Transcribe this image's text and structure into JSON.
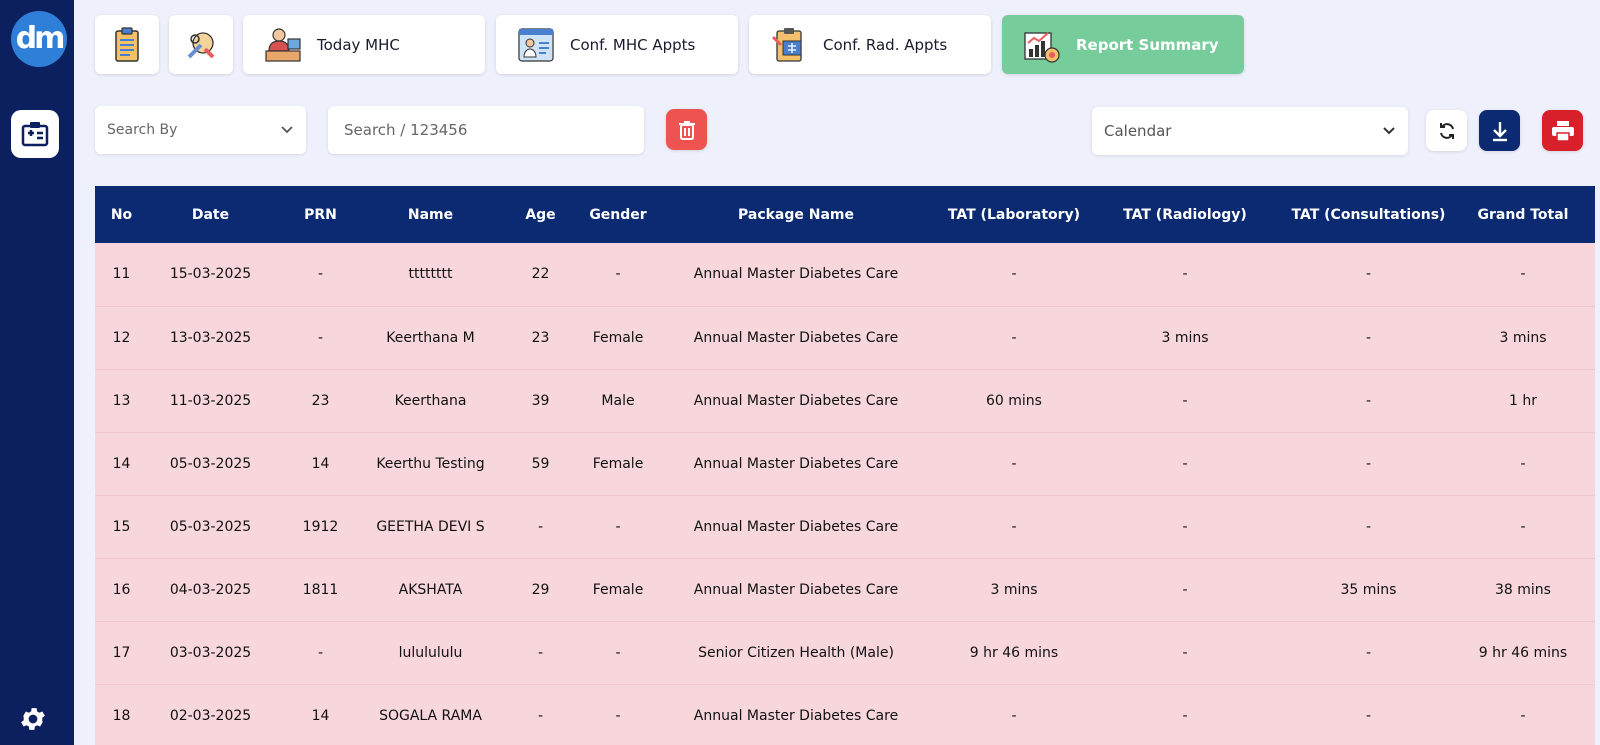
{
  "app": {
    "logo_text": "dm"
  },
  "sidebar": {
    "settings_icon": "gear-icon",
    "nav_icon": "medical-id-icon"
  },
  "tiles": [
    {
      "label": "",
      "icon": "clipboard-icon"
    },
    {
      "label": "",
      "icon": "tools-icon"
    },
    {
      "label": "Today MHC",
      "icon": "doctor-desk-icon"
    },
    {
      "label": "Conf. MHC Appts",
      "icon": "doctor-card-icon"
    },
    {
      "label": "Conf. Rad. Appts",
      "icon": "radiology-clipboard-icon"
    },
    {
      "label": "Report Summary",
      "icon": "report-chart-icon",
      "active": true
    }
  ],
  "filters": {
    "search_by": "Search By",
    "search_placeholder": "Search / 123456",
    "calendar": "Calendar"
  },
  "colors": {
    "sidebar": "#0c1f5e",
    "header": "#0c2a72",
    "row": "#f7d7dc",
    "active_tile": "#76cc9b",
    "danger": "#e53e3e",
    "download": "#0c2a72"
  },
  "table": {
    "columns": [
      "No",
      "Date",
      "PRN",
      "Name",
      "Age",
      "Gender",
      "Package Name",
      "TAT (Laboratory)",
      "TAT (Radiology)",
      "TAT (Consultations)",
      "Grand Total"
    ],
    "rows": [
      [
        "11",
        "15-03-2025",
        "-",
        "tttttttt",
        "22",
        "-",
        "Annual Master Diabetes Care",
        "-",
        "-",
        "-",
        "-"
      ],
      [
        "12",
        "13-03-2025",
        "-",
        "Keerthana M",
        "23",
        "Female",
        "Annual Master Diabetes Care",
        "-",
        "3 mins",
        "-",
        "3 mins"
      ],
      [
        "13",
        "11-03-2025",
        "23",
        "Keerthana",
        "39",
        "Male",
        "Annual Master Diabetes Care",
        "60 mins",
        "-",
        "-",
        "1 hr"
      ],
      [
        "14",
        "05-03-2025",
        "14",
        "Keerthu Testing",
        "59",
        "Female",
        "Annual Master Diabetes Care",
        "-",
        "-",
        "-",
        "-"
      ],
      [
        "15",
        "05-03-2025",
        "1912",
        "GEETHA DEVI S",
        "-",
        "-",
        "Annual Master Diabetes Care",
        "-",
        "-",
        "-",
        "-"
      ],
      [
        "16",
        "04-03-2025",
        "1811",
        "AKSHATA",
        "29",
        "Female",
        "Annual Master Diabetes Care",
        "3 mins",
        "-",
        "35 mins",
        "38 mins"
      ],
      [
        "17",
        "03-03-2025",
        "-",
        "lululululu",
        "-",
        "-",
        "Senior Citizen Health (Male)",
        "9 hr 46 mins",
        "-",
        "-",
        "9 hr 46 mins"
      ],
      [
        "18",
        "02-03-2025",
        "14",
        "SOGALA RAMA",
        "-",
        "-",
        "Annual Master Diabetes Care",
        "-",
        "-",
        "-",
        "-"
      ]
    ]
  }
}
